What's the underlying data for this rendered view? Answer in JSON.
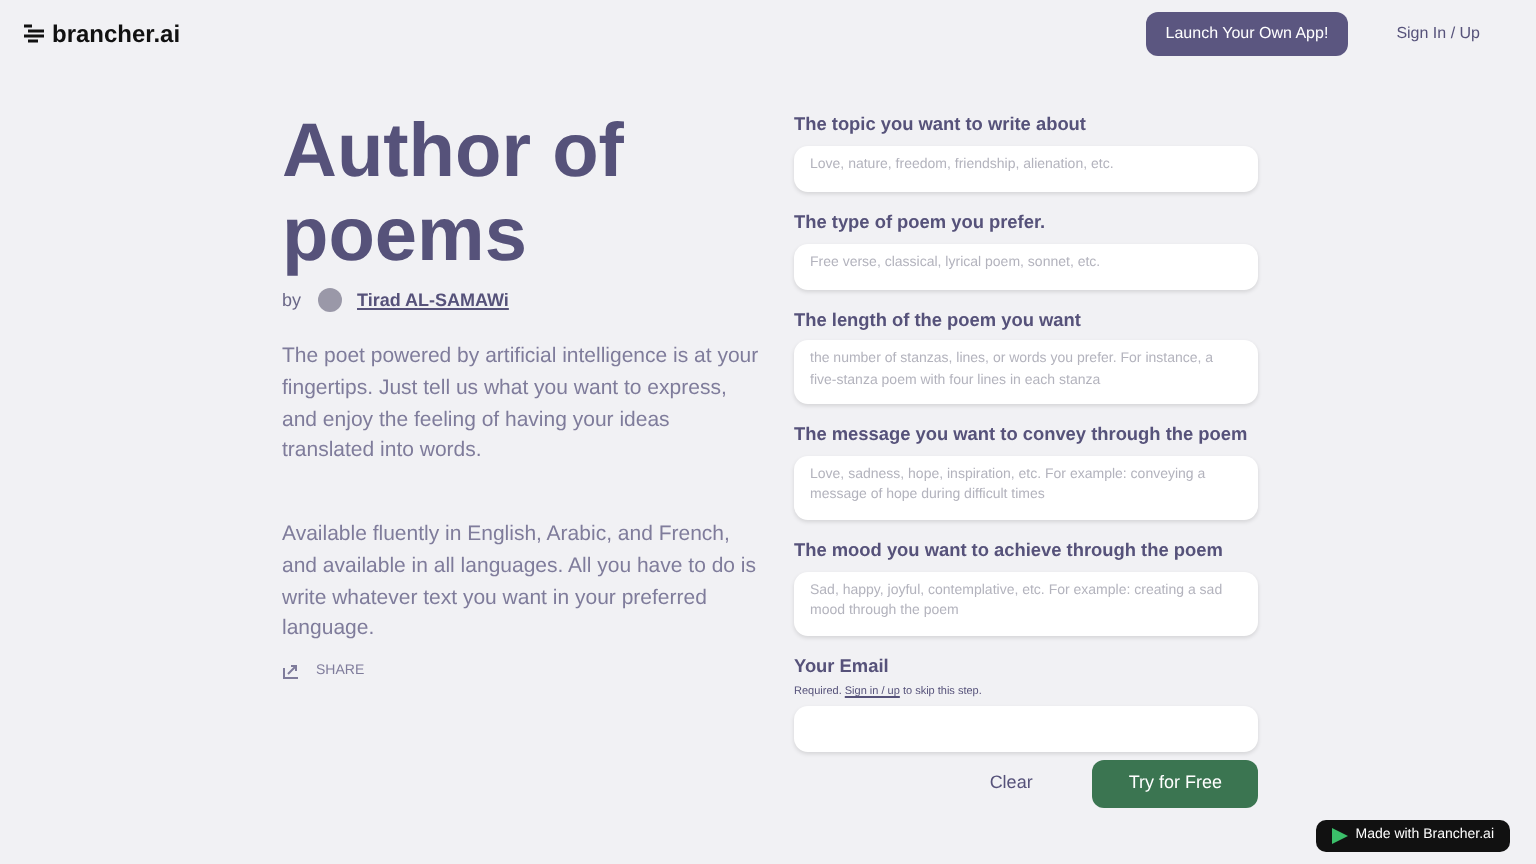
{
  "nav": {
    "logo": "brancher.ai",
    "launch_button": "Launch Your Own App!",
    "sign_in": "Sign In / Up"
  },
  "hero": {
    "title": "Author of poems",
    "by": "by",
    "author": "Tirad AL-SAMAWi",
    "paragraphs": [
      "The poet powered by artificial intelligence is at your fingertips. Just tell us what you want to express, and enjoy the feeling of having your ideas translated into words.",
      "Available fluently in English, Arabic, and French, and available in all languages. All you have to do is write whatever text you want in your preferred language."
    ],
    "share": "SHARE"
  },
  "form": {
    "fields": [
      {
        "label": "The topic you want to write about",
        "placeholder": "Love, nature, freedom, friendship, alienation, etc.",
        "kind": "single"
      },
      {
        "label": "The type of poem you prefer.",
        "placeholder": "Free verse, classical, lyrical poem, sonnet, etc.",
        "kind": "single"
      },
      {
        "label": "The length of the poem you want",
        "placeholder": "the number of stanzas, lines, or words you prefer. For instance, a five-stanza poem with four lines in each stanza",
        "kind": "multi"
      },
      {
        "label": "The message you want to convey through the poem",
        "placeholder": "Love, sadness, hope, inspiration, etc. For example: conveying a message of hope during difficult times",
        "kind": "multi"
      },
      {
        "label": "The mood you want to achieve through the poem",
        "placeholder": "Sad, happy, joyful, contemplative, etc. For example: creating a sad mood through the poem",
        "kind": "multi"
      }
    ],
    "email": {
      "label": "Your Email",
      "note_before": "Required.",
      "note_link": "Sign in / up",
      "note_after": "to skip this step."
    },
    "clear_button": "Clear",
    "submit_button": "Try for Free"
  },
  "badge": "Made with Brancher.ai"
}
